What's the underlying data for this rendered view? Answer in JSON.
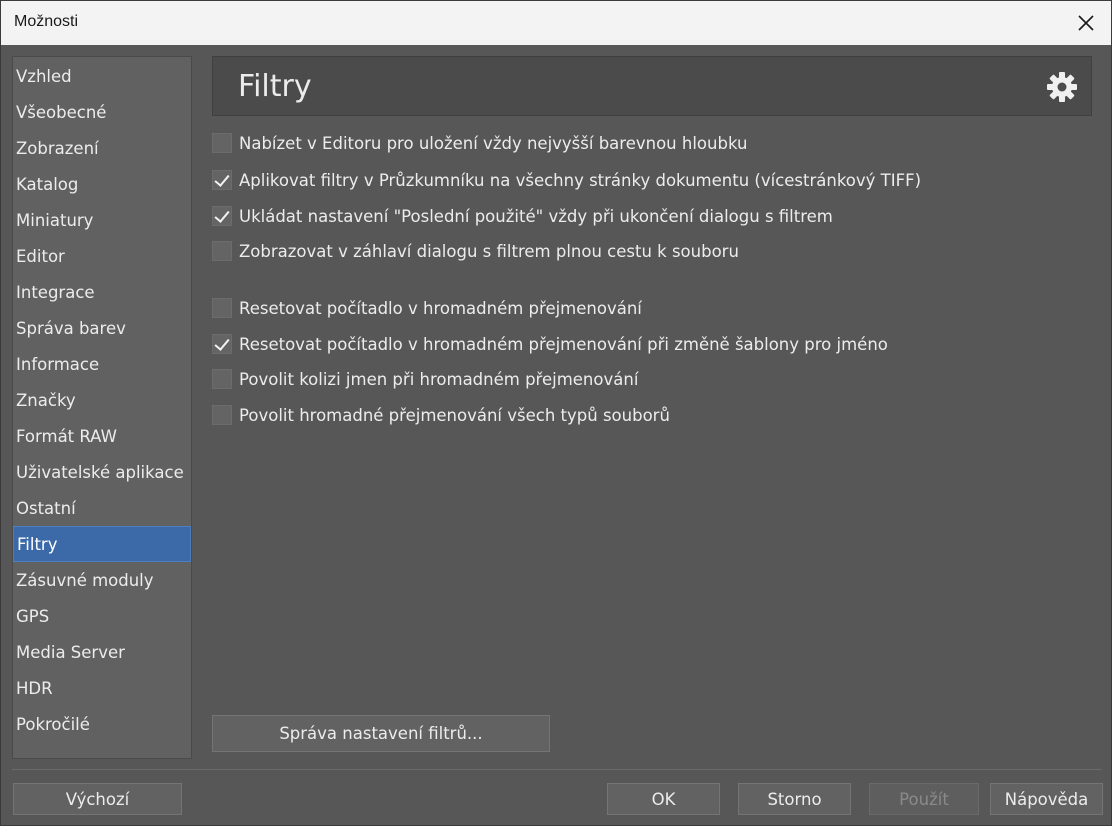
{
  "window": {
    "title": "Možnosti"
  },
  "sidebar": {
    "items": [
      {
        "label": "Vzhled"
      },
      {
        "label": "Všeobecné"
      },
      {
        "label": "Zobrazení"
      },
      {
        "label": "Katalog"
      },
      {
        "label": "Miniatury"
      },
      {
        "label": "Editor"
      },
      {
        "label": "Integrace"
      },
      {
        "label": "Správa barev"
      },
      {
        "label": "Informace"
      },
      {
        "label": "Značky"
      },
      {
        "label": "Formát RAW"
      },
      {
        "label": "Uživatelské aplikace"
      },
      {
        "label": "Ostatní"
      },
      {
        "label": "Filtry",
        "selected": true
      },
      {
        "label": "Zásuvné moduly"
      },
      {
        "label": "GPS"
      },
      {
        "label": "Media Server"
      },
      {
        "label": "HDR"
      },
      {
        "label": "Pokročilé"
      }
    ]
  },
  "panel": {
    "title": "Filtry",
    "options": [
      {
        "label": "Nabízet v Editoru pro uložení vždy nejvyšší barevnou hloubku",
        "checked": false
      },
      {
        "label": "Aplikovat filtry v Průzkumníku na všechny stránky dokumentu (vícestránkový TIFF)",
        "checked": true
      },
      {
        "label": "Ukládat nastavení \"Poslední použité\" vždy při ukončení dialogu s filtrem",
        "checked": true
      },
      {
        "label": "Zobrazovat v záhlaví dialogu s filtrem plnou cestu k souboru",
        "checked": false
      },
      {
        "label": "Resetovat počítadlo v hromadném přejmenování",
        "checked": false
      },
      {
        "label": "Resetovat počítadlo v hromadném přejmenování při změně šablony pro jméno",
        "checked": true
      },
      {
        "label": "Povolit kolizi jmen při hromadném přejmenování",
        "checked": false
      },
      {
        "label": "Povolit hromadné přejmenování všech typů souborů",
        "checked": false
      }
    ],
    "manage_button": "Správa nastavení filtrů..."
  },
  "footer": {
    "default_button": "Výchozí",
    "ok_button": "OK",
    "cancel_button": "Storno",
    "apply_button": "Použít",
    "help_button": "Nápověda"
  },
  "colors": {
    "selected": "#3c6aa8",
    "background": "#575757"
  }
}
